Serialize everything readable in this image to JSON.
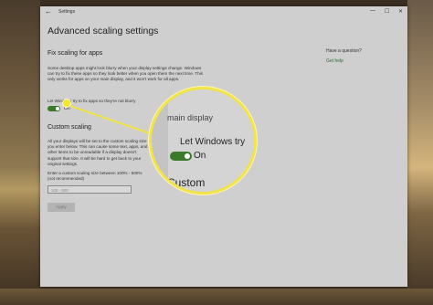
{
  "window": {
    "app_title": "Settings",
    "page_title": "Advanced scaling settings"
  },
  "fix_scaling": {
    "title": "Fix scaling for apps",
    "description": "Some desktop apps might look blurry when your display settings change. Windows can try to fix these apps so they look better when you open them the next time. This only works for apps on your main display, and it won't work for all apps.",
    "toggle_label": "Let Windows try to fix apps so they're not blurry",
    "toggle_state": "On",
    "toggle_on": true
  },
  "custom_scaling": {
    "title": "Custom scaling",
    "description": "All your displays will be set to the custom scaling size you enter below. This can cause some text, apps, and other items to be unreadable if a display doesn't support that size. It will be hard to get back to your original settings.",
    "input_label": "Enter a custom scaling size between 100% - 500% (not recommended)",
    "input_placeholder": "100 - 500",
    "apply_label": "Apply"
  },
  "help": {
    "question": "Have a question?",
    "link": "Get help"
  },
  "magnifier": {
    "line1": "main display",
    "line2": "Let Windows try",
    "toggle_state": "On",
    "line3": "Custom"
  },
  "colors": {
    "accent": "#3a7a2a",
    "callout": "#f2e34a",
    "link": "#2e6e2e"
  }
}
